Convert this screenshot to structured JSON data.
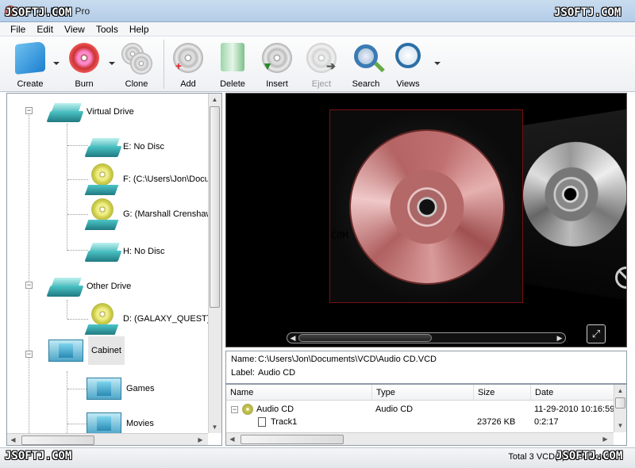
{
  "window": {
    "title": "Virtual Drive Pro"
  },
  "watermark": "JSOFTJ.COM",
  "overlay_text": "COM",
  "menu": [
    "File",
    "Edit",
    "View",
    "Tools",
    "Help"
  ],
  "toolbar": {
    "create": "Create",
    "burn": "Burn",
    "clone": "Clone",
    "add": "Add",
    "delete": "Delete",
    "insert": "Insert",
    "eject": "Eject",
    "search": "Search",
    "views": "Views"
  },
  "tree": {
    "virtual_drive": "Virtual Drive",
    "e": "E: No Disc",
    "f": "F: (C:\\Users\\Jon\\Docu",
    "g": "G: (Marshall Crenshaw",
    "h": "H: No Disc",
    "other_drive": "Other Drive",
    "d": "D: (GALAXY_QUEST)",
    "cabinet": "Cabinet",
    "games": "Games",
    "movies": "Movies"
  },
  "props": {
    "name_label": "Name:",
    "name_value": "C:\\Users\\Jon\\Documents\\VCD\\Audio CD.VCD",
    "label_label": "Label:",
    "label_value": "Audio CD"
  },
  "filelist": {
    "columns": [
      "Name",
      "Type",
      "Size",
      "Date"
    ],
    "rows": [
      {
        "name": "Audio CD",
        "type": "Audio CD",
        "size": "",
        "date": "11-29-2010 10:16:59"
      },
      {
        "name": "Track1",
        "type": "",
        "size": "23726 KB",
        "date": "0:2:17"
      }
    ]
  },
  "status": {
    "text": "Total 3 VCD(s), 0 Selected"
  },
  "colors": {
    "accent": "#1c7fcf",
    "cover_frame": "#7a1010"
  }
}
